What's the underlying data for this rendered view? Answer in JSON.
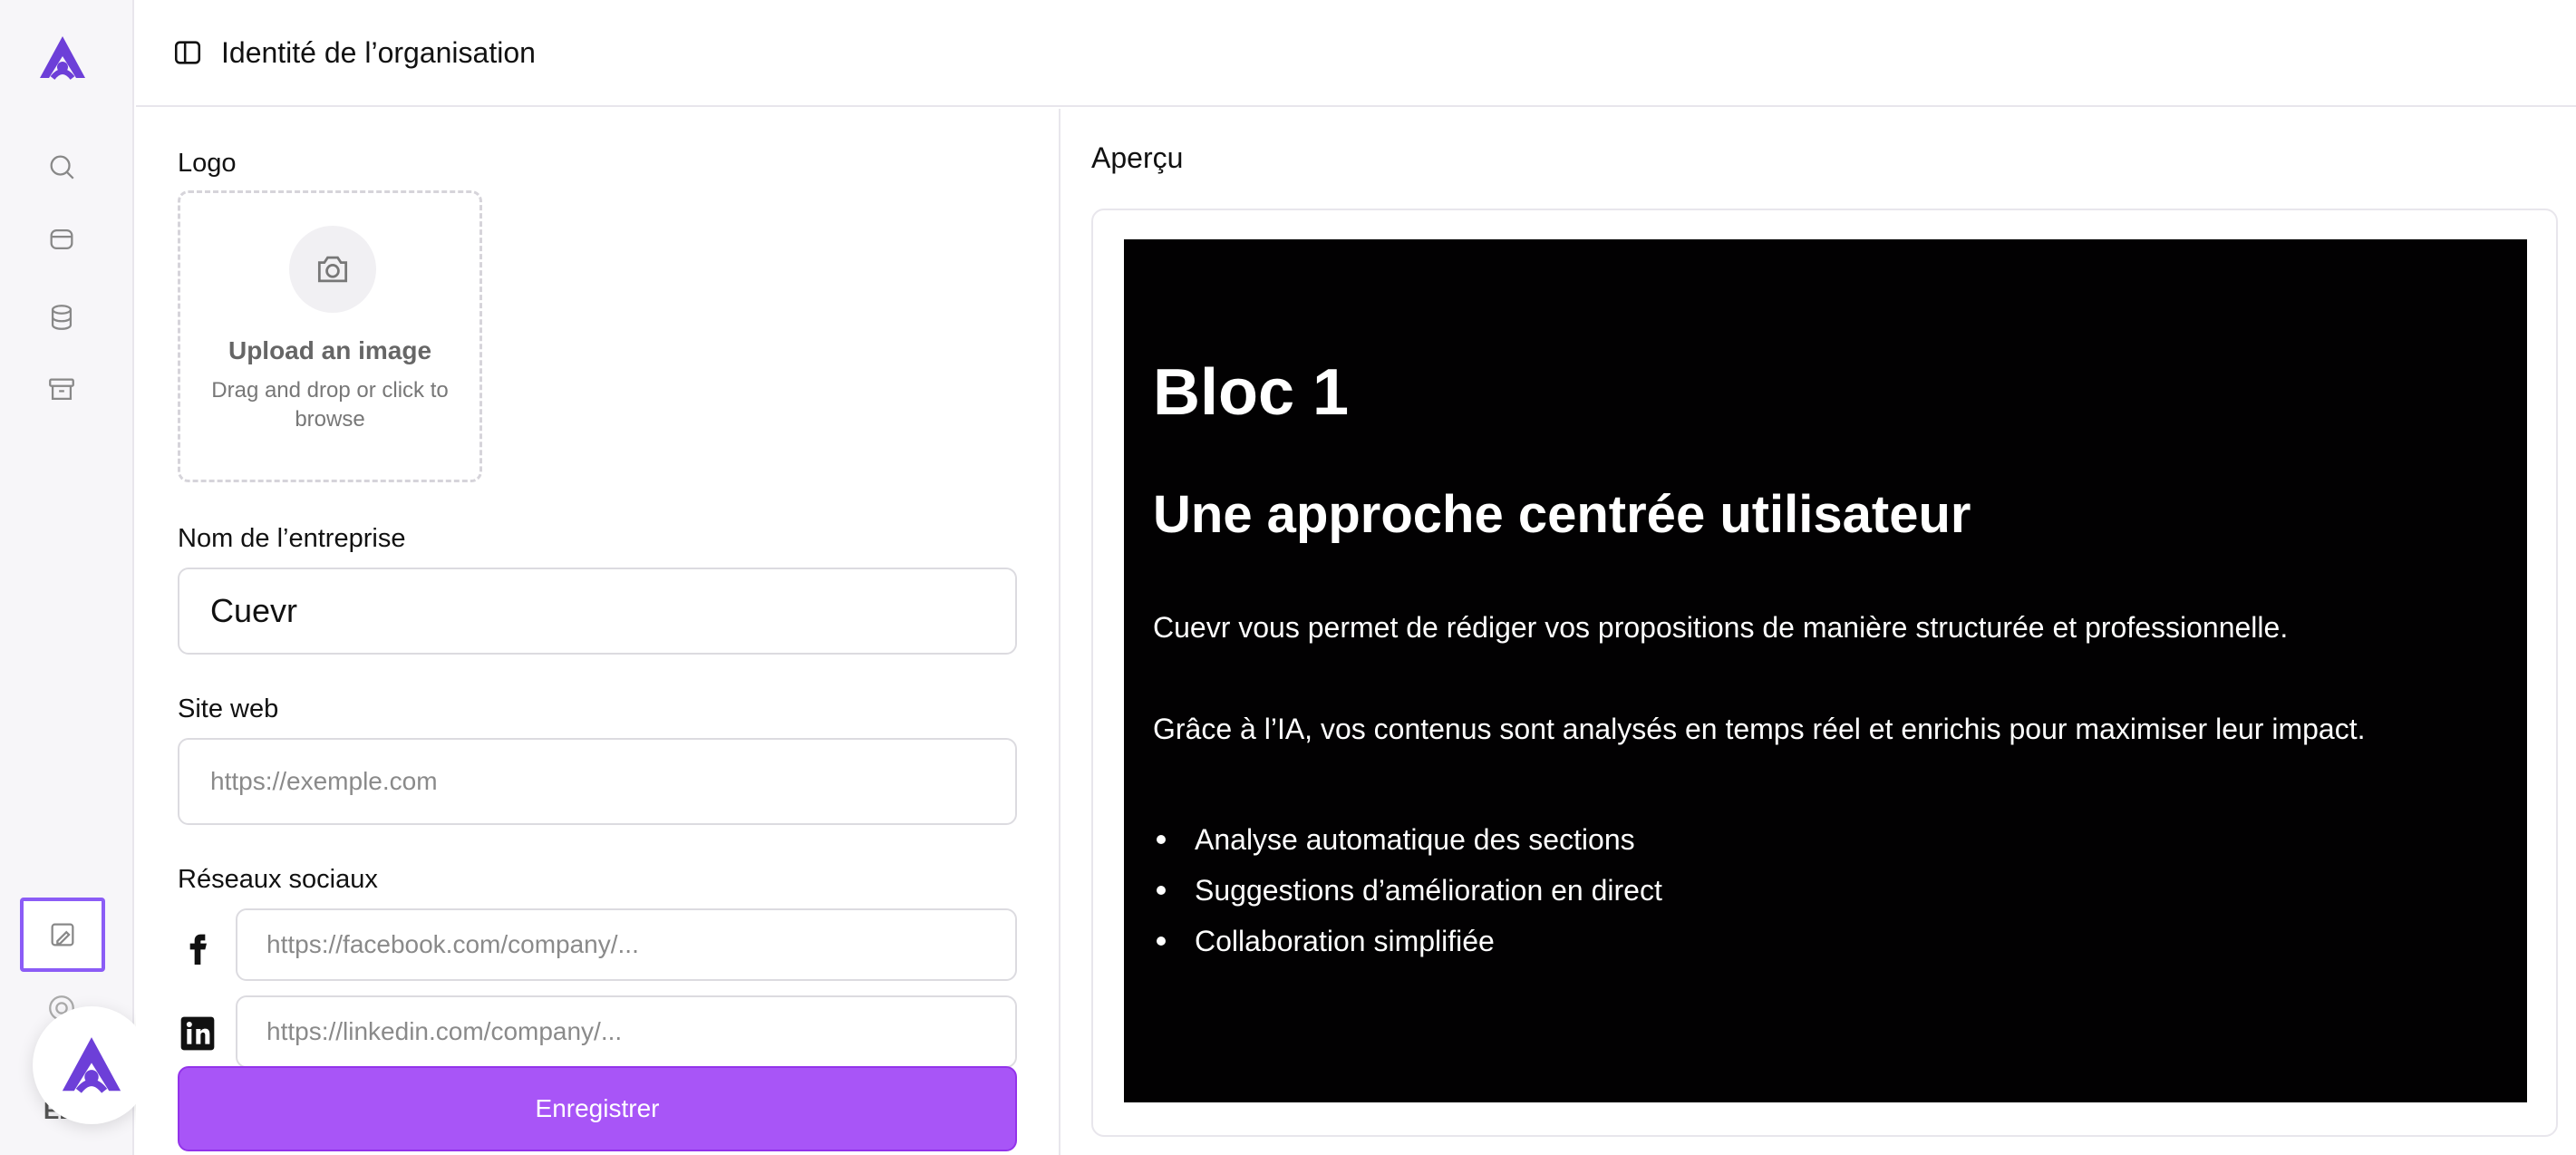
{
  "header": {
    "title": "Identité de l’organisation"
  },
  "form": {
    "logo_label": "Logo",
    "upload_title": "Upload an image",
    "upload_subtitle": "Drag and drop or click to browse",
    "company_label": "Nom de l’entreprise",
    "company_value": "Cuevr",
    "website_label": "Site web",
    "website_placeholder": "https://exemple.com",
    "social_label": "Réseaux sociaux",
    "facebook_placeholder": "https://facebook.com/company/...",
    "linkedin_placeholder": "https://linkedin.com/company/...",
    "save_label": "Enregistrer"
  },
  "preview": {
    "label": "Aperçu",
    "heading1": "Bloc 1",
    "heading2": "Une approche centrée utilisateur",
    "paragraph1": "Cuevr vous permet de rédiger vos propositions de manière structurée et professionnelle.",
    "paragraph2": "Grâce à l’IA, vos contenus sont analysés en temps réel et enrichis pour maximiser leur impact.",
    "bullets": [
      "Analyse automatique des sections",
      "Suggestions d’amélioration en direct",
      "Collaboration simplifiée"
    ]
  },
  "sidebar": {
    "icons": [
      "search-icon",
      "inbox-icon",
      "database-icon",
      "archive-icon",
      "brush-icon",
      "help-icon"
    ],
    "user_initials": "EE"
  },
  "colors": {
    "accent": "#a855f7",
    "brand": "#6d3fd8",
    "slide_bg": "#020102"
  }
}
